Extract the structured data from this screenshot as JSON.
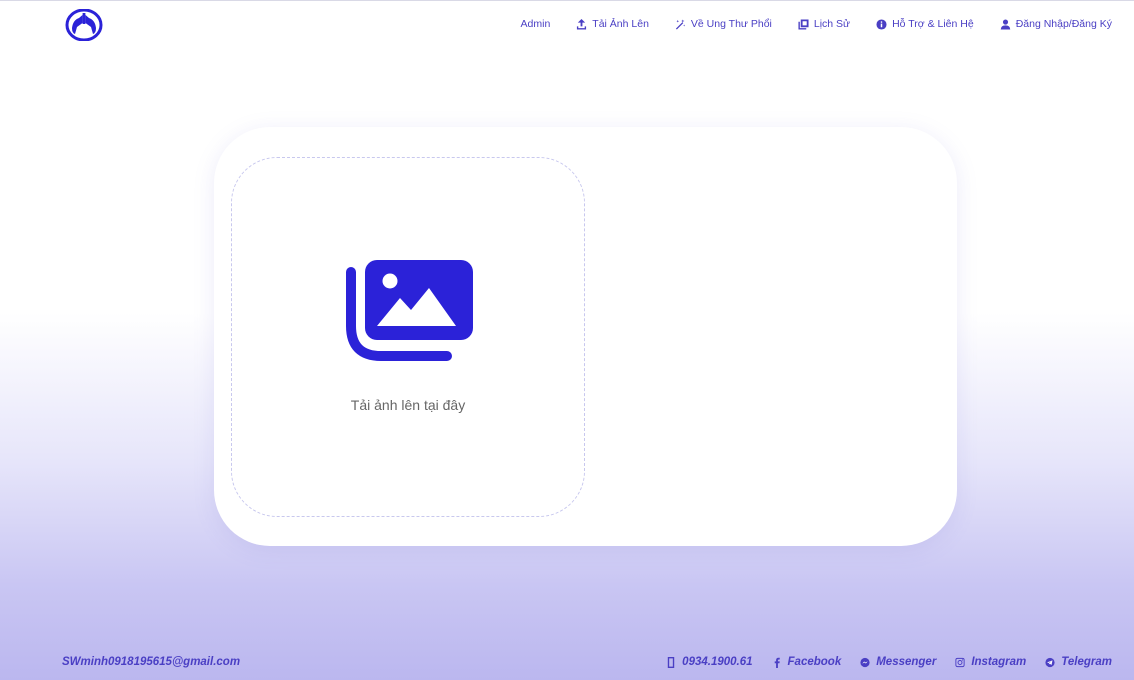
{
  "header": {
    "logo_icon": "lungs-logo-icon",
    "nav": [
      {
        "label": "Admin",
        "icon": ""
      },
      {
        "label": "Tải Ảnh Lên",
        "icon": "upload-icon"
      },
      {
        "label": "Về Ung Thư Phổi",
        "icon": "magic-wand-icon"
      },
      {
        "label": "Lịch Sử",
        "icon": "history-icon"
      },
      {
        "label": "Hỗ Trợ & Liên Hệ",
        "icon": "info-icon"
      },
      {
        "label": "Đăng Nhập/Đăng Ký",
        "icon": "user-icon"
      }
    ]
  },
  "upload": {
    "label": "Tải ảnh lên tại đây",
    "icon": "images-icon"
  },
  "footer": {
    "email": "SWminh0918195615@gmail.com",
    "links": [
      {
        "label": "0934.1900.61",
        "icon": "phone-icon"
      },
      {
        "label": "Facebook",
        "icon": "facebook-icon"
      },
      {
        "label": "Messenger",
        "icon": "messenger-icon"
      },
      {
        "label": "Instagram",
        "icon": "instagram-icon"
      },
      {
        "label": "Telegram",
        "icon": "telegram-icon"
      }
    ]
  },
  "colors": {
    "accent": "#4a3fc4",
    "icon_blue": "#2b22d8",
    "gradient_bottom": "#bbb7ef"
  }
}
